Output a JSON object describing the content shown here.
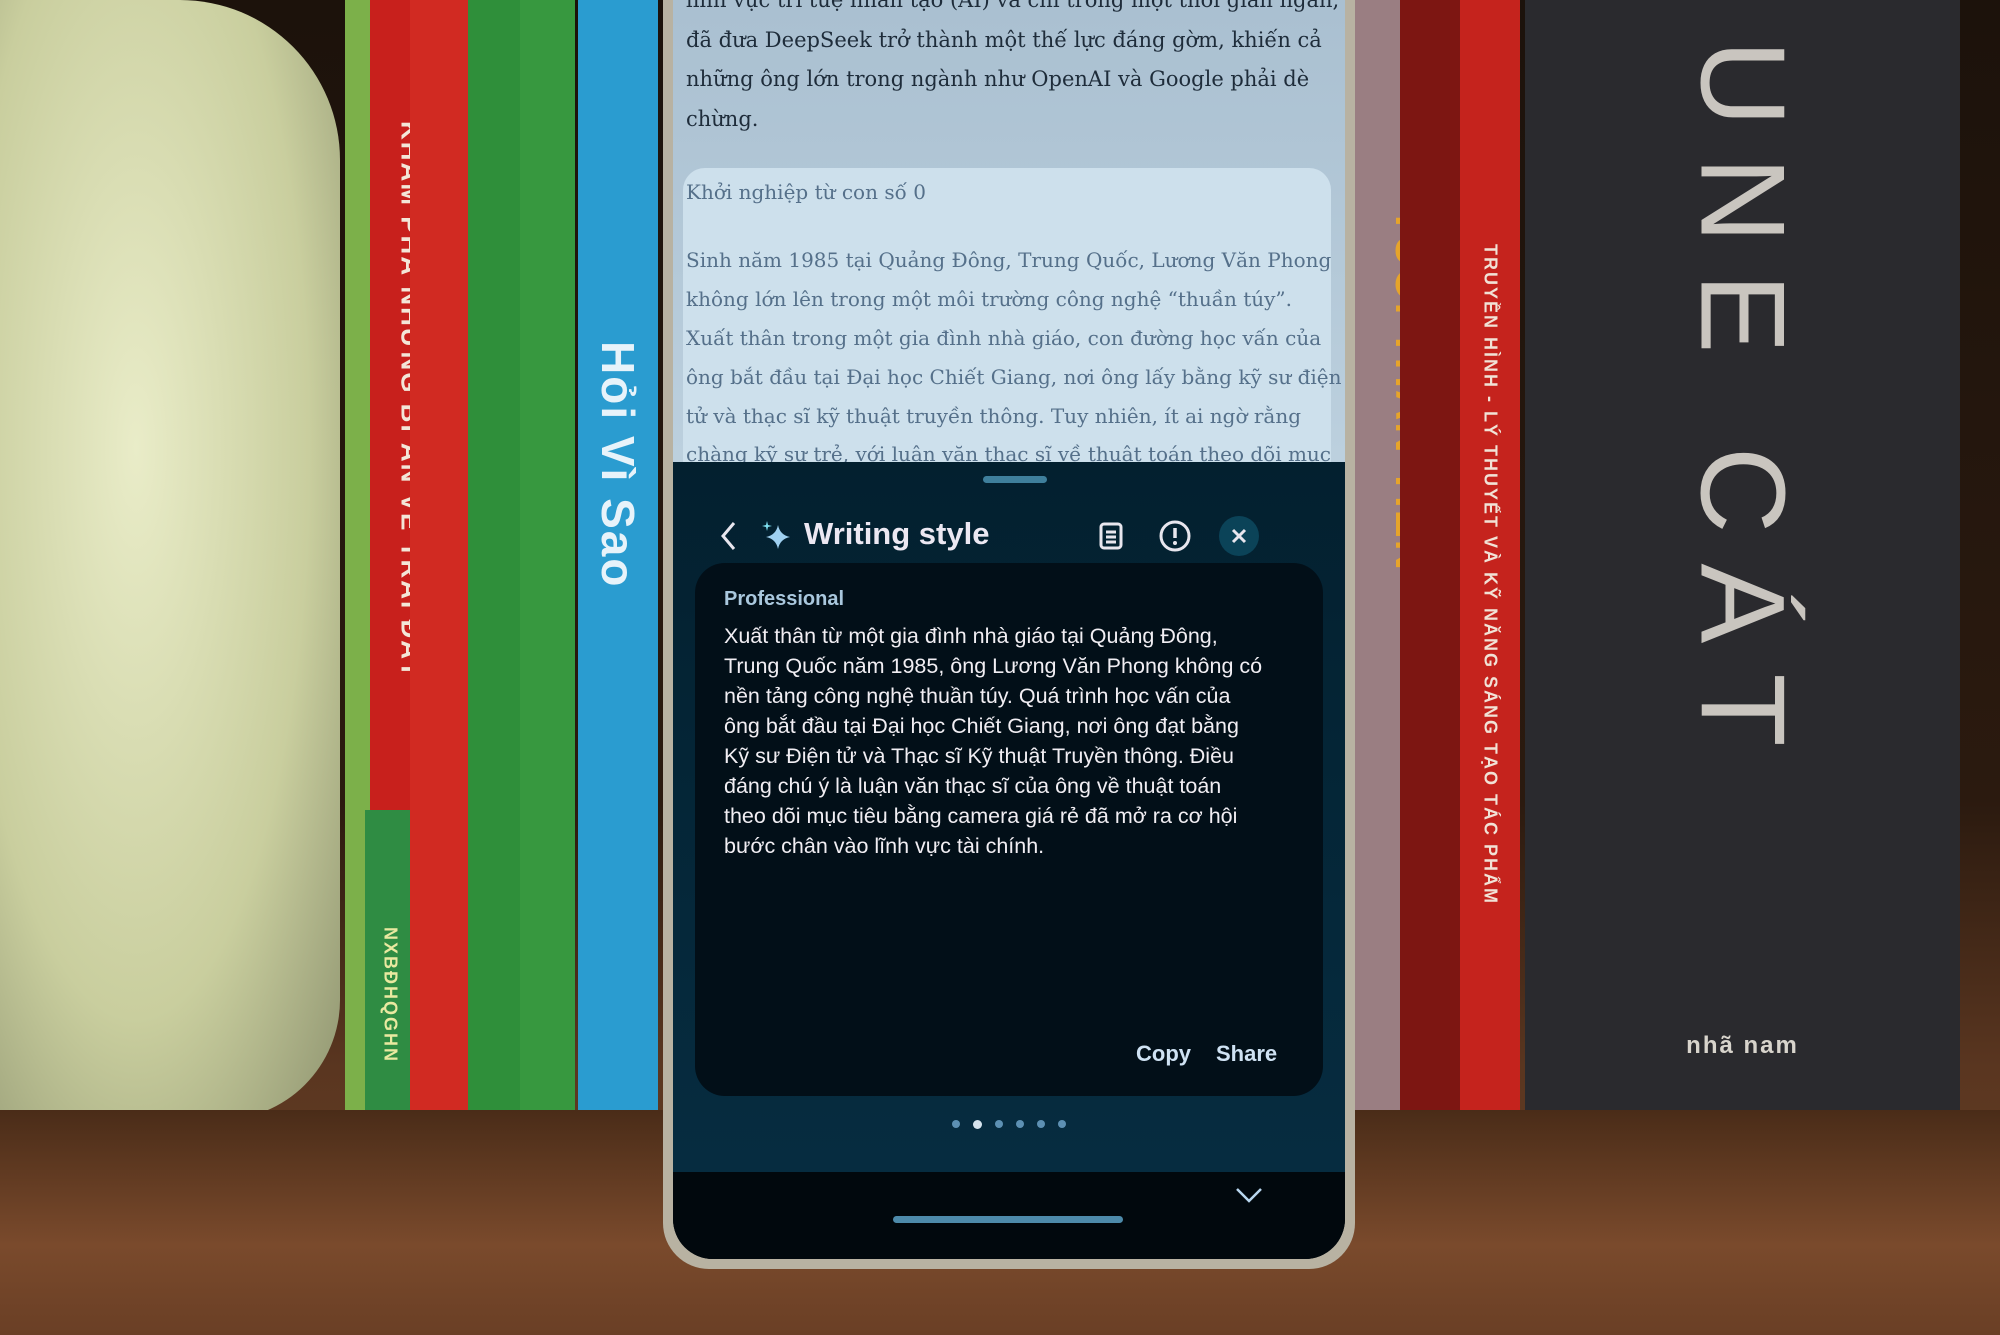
{
  "article": {
    "intro_lines": [
      "lĩnh vực trí tuệ nhân tạo (AI) và chỉ trong một thời gian ngắn,",
      "đã đưa DeepSeek trở thành một thế lực đáng gờm, khiến cả",
      "những ông lớn trong ngành như OpenAI và Google phải dè",
      "chừng."
    ],
    "heading": "Khởi nghiệp từ con số 0",
    "selected_lines": [
      "Sinh năm 1985 tại Quảng Đông, Trung Quốc, Lương Văn Phong",
      "không lớn lên trong một môi trường công nghệ “thuần túy”.",
      "Xuất thân trong một gia đình nhà giáo, con đường học vấn của",
      "ông bắt đầu tại Đại học Chiết Giang, nơi ông lấy bằng kỹ sư điện",
      "tử và thạc sĩ kỹ thuật truyền thông. Tuy nhiên, ít ai ngờ rằng",
      "chàng kỹ sư trẻ, với luận văn thạc sĩ về thuật toán theo dõi mục"
    ]
  },
  "panel": {
    "title": "Writing style",
    "icons": {
      "back": "chevron-left-icon",
      "sparkle": "sparkle-icon",
      "compare": "compare-icon",
      "report": "exclamation-circle-icon",
      "close": "close-icon"
    },
    "style_label": "Professional",
    "result_lines": [
      "Xuất thân từ một gia đình nhà giáo tại Quảng Đông,",
      "Trung Quốc năm 1985, ông Lương Văn Phong không có",
      "nền tảng công nghệ thuần túy.  Quá trình học vấn của",
      "ông bắt đầu tại Đại học Chiết Giang, nơi ông đạt bằng",
      "Kỹ sư Điện tử và Thạc sĩ Kỹ thuật Truyền thông.  Điều",
      "đáng chú ý là luận văn thạc sĩ của ông về thuật toán",
      "theo dõi mục tiêu bằng camera giá rẻ đã mở ra cơ hội",
      "bước chân vào lĩnh vực tài chính."
    ],
    "copy_label": "Copy",
    "share_label": "Share",
    "page_count": 6,
    "active_page": 2
  },
  "books": {
    "left_1": "KHÁM PHÁ NHỮNG BÍ ẨN VỀ TRÁI ĐẤT",
    "left_1_publisher": "NXBĐHQGHN",
    "left_2": "Hỏi Vì Sao",
    "right_1": "TUỔI THẦN TIÊN",
    "right_2": "TRUYỀN HÌNH - LÝ THUYẾT VÀ KỸ NĂNG SÁNG TẠO TÁC PHẨM",
    "right_3": "UNE CÁT",
    "right_3_publisher": "nhã nam"
  },
  "colors": {
    "panel_bg": "#03202f",
    "card_bg": "#020f18",
    "accent": "#a9c7dd",
    "article_bg": "#bcd0de"
  }
}
